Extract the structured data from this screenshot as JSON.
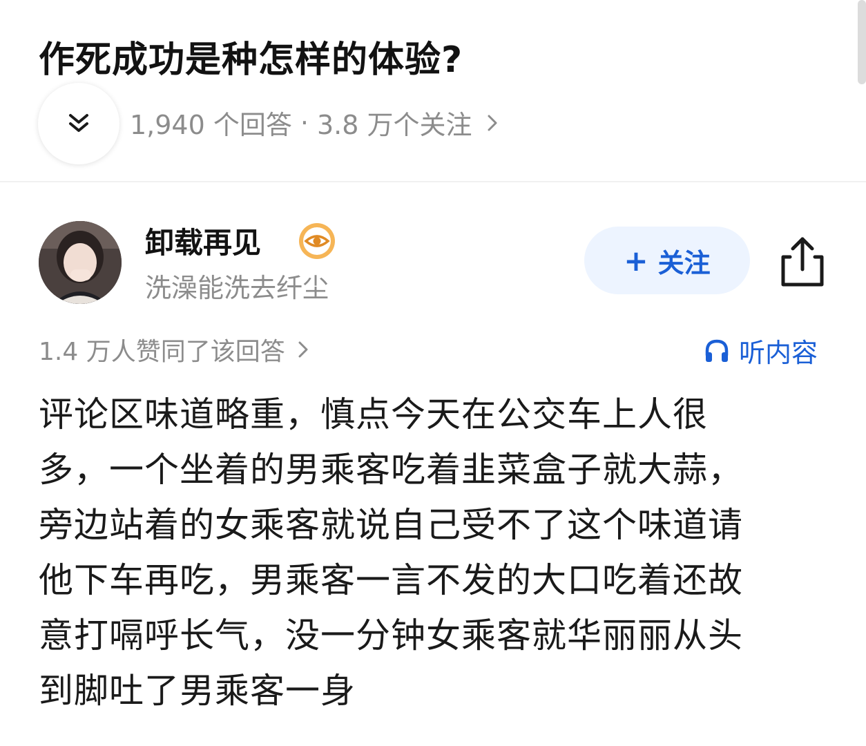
{
  "question": {
    "title": "作死成功是种怎样的体验?",
    "answers_count": "1,940 个回答",
    "separator": "·",
    "followers_count": "3.8 万个关注"
  },
  "author": {
    "name": "卸载再见",
    "bio": "洗澡能洗去纤尘"
  },
  "actions": {
    "follow_label": "关注",
    "follow_plus": "+",
    "listen_label": "听内容"
  },
  "answer": {
    "upvote_summary": "1.4 万人赞同了该回答",
    "lines": [
      "评论区味道略重，慎点今天在公交车上人很",
      "多，一个坐着的男乘客吃着韭菜盒子就大蒜，",
      "旁边站着的女乘客就说自己受不了这个味道请",
      "他下车再吃，男乘客一言不发的大口吃着还故",
      "意打嗝呼长气，没一分钟女乘客就华丽丽从头",
      "到脚吐了男乘客一身"
    ]
  },
  "icons": {
    "collapse": "double-chevron-down-icon",
    "badge": "eye-badge-icon",
    "share": "share-icon",
    "listen": "headphones-icon",
    "chevron": "chevron-right-icon"
  },
  "colors": {
    "accent": "#1a5fd6",
    "follow_bg": "#edf4ff",
    "muted_text": "#8c8c8c",
    "badge": "#f0a33a"
  }
}
